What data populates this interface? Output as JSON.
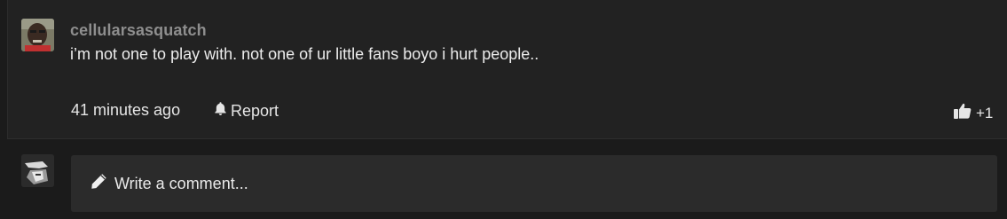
{
  "comment": {
    "username": "cellularsasquatch",
    "text": "i’m not one to play with. not one of ur little fans boyo i hurt people..",
    "time": "41 minutes ago",
    "report_label": "Report",
    "like_count": "+1",
    "icons": {
      "report": "bell-icon",
      "like": "thumbs-up-icon"
    }
  },
  "reply": {
    "placeholder": "Write a comment...",
    "icon": "pencil-icon"
  },
  "colors": {
    "page_background": "#1b1b1b",
    "comment_background": "#222222",
    "input_background": "#2b2b2b",
    "username": "#8e8e8e",
    "text": "#ececec"
  }
}
